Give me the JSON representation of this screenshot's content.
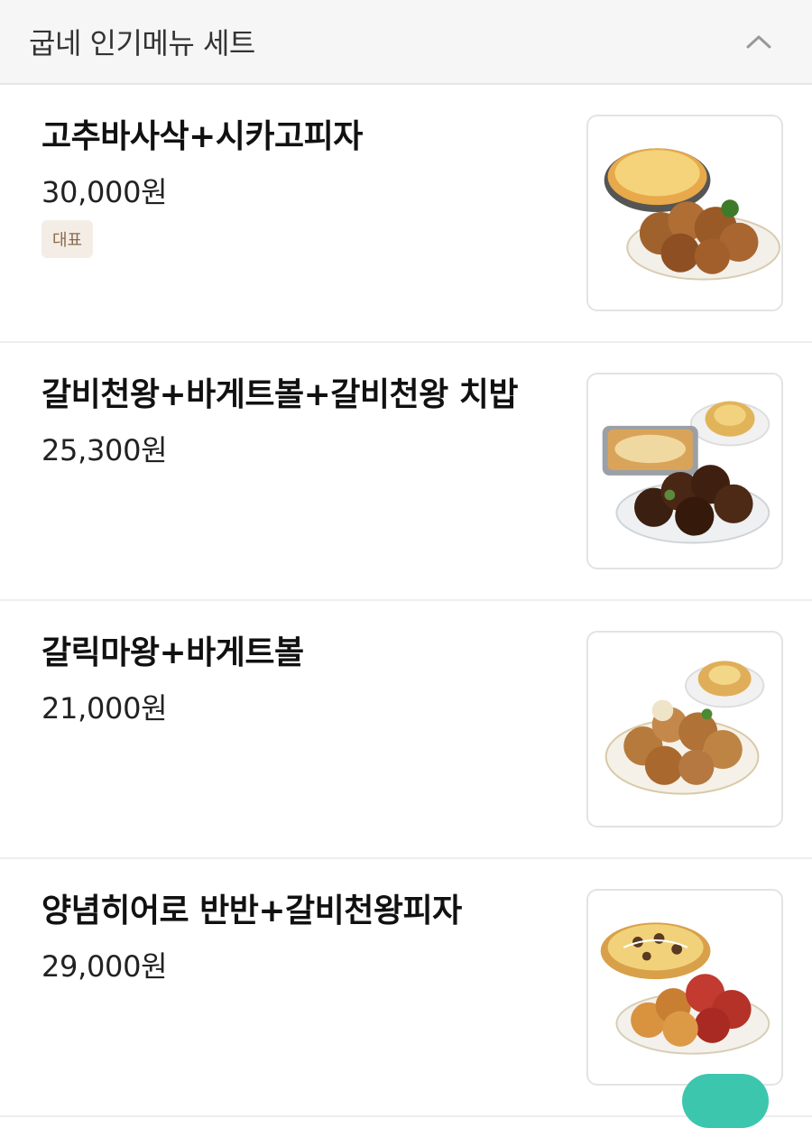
{
  "section": {
    "title": "굽네 인기메뉴 세트",
    "collapse_icon": "chevron-up-icon"
  },
  "menu_items": [
    {
      "name": "고추바사삭+시카고피자",
      "price": "30,000원",
      "badge": "대표",
      "image_icon": "pizza-chicken-photo"
    },
    {
      "name": "갈비천왕+바게트볼+갈비천왕 치밥",
      "price": "25,300원",
      "image_icon": "chicken-rice-bread-photo"
    },
    {
      "name": "갈릭마왕+바게트볼",
      "price": "21,000원",
      "image_icon": "garlic-chicken-bread-photo"
    },
    {
      "name": "양념히어로 반반+갈비천왕피자",
      "price": "29,000원",
      "image_icon": "pizza-chicken-photo"
    }
  ],
  "colors": {
    "header_bg": "#f6f6f6",
    "badge_bg": "#f3ede6",
    "badge_text": "#8a6a4b",
    "accent": "#3cc6ae"
  }
}
